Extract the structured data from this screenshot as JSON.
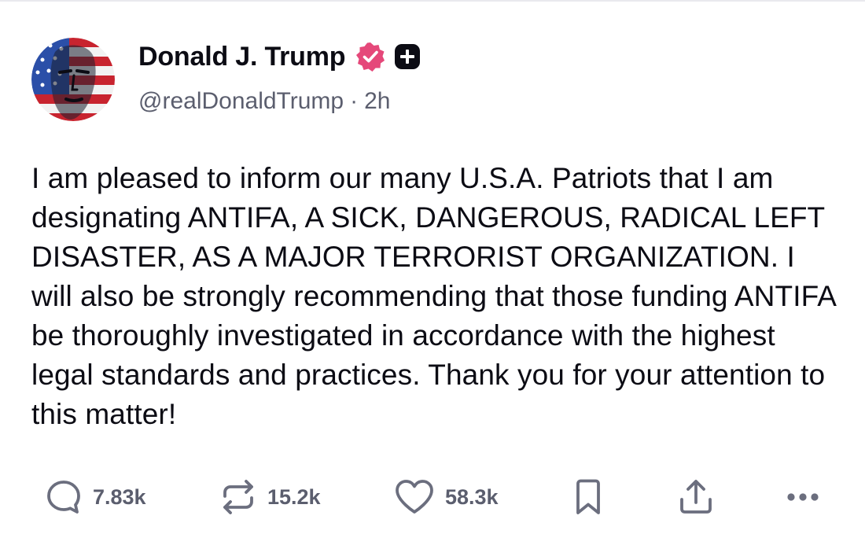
{
  "author": {
    "display_name": "Donald J. Trump",
    "handle": "@realDonaldTrump",
    "separator": "·",
    "time_ago": "2h",
    "avatar": "avatar-flag-portrait",
    "verified_icon": "verified-badge-icon",
    "truth_plus_icon": "truth-plus-badge-icon"
  },
  "post": {
    "text": "I am pleased to inform our many U.S.A. Patriots that I am designating ANTIFA, A SICK, DANGEROUS, RADICAL LEFT DISASTER, AS A MAJOR TERRORIST ORGANIZATION. I will also be strongly recommending that those funding ANTIFA be thoroughly investigated in accordance with the highest legal standards and practices. Thank you for your attention to this matter!"
  },
  "actions": {
    "reply": {
      "icon": "reply-icon",
      "count": "7.83k"
    },
    "retruth": {
      "icon": "retruth-icon",
      "count": "15.2k"
    },
    "like": {
      "icon": "heart-icon",
      "count": "58.3k"
    },
    "bookmark": {
      "icon": "bookmark-icon"
    },
    "share": {
      "icon": "share-icon"
    },
    "more": {
      "icon": "more-icon"
    }
  },
  "colors": {
    "verified_badge": "#e5487a",
    "truth_plus_badge": "#0c0c14",
    "text_primary": "#0c0c14",
    "text_secondary": "#5b5e6e",
    "icon": "#6b6e7e"
  }
}
